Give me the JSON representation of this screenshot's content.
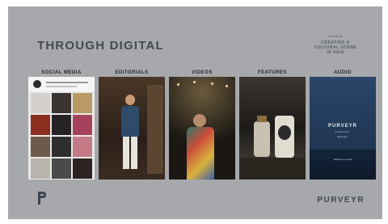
{
  "slide": {
    "title": "THROUGH DIGITAL",
    "kicker_top": "PURVEYR",
    "kicker_lines": [
      "CREATING A",
      "CULTURAL SCENE",
      "IN ASIA"
    ],
    "footer_brand": "PURVEYR"
  },
  "columns": [
    {
      "label": "SOCIAL MEDIA"
    },
    {
      "label": "EDITORIALS"
    },
    {
      "label": "VIDEOS"
    },
    {
      "label": "FEATURES"
    },
    {
      "label": "AUDIO"
    }
  ],
  "audio_card": {
    "brand": "PURVEYR",
    "subtitle": "PODCAST",
    "episode": "Episode 1",
    "footer": "Welcome to Asia"
  },
  "colors": {
    "slide_bg": "#a6a8ab",
    "title": "#444a51",
    "audio_bg": "#1e3552"
  }
}
